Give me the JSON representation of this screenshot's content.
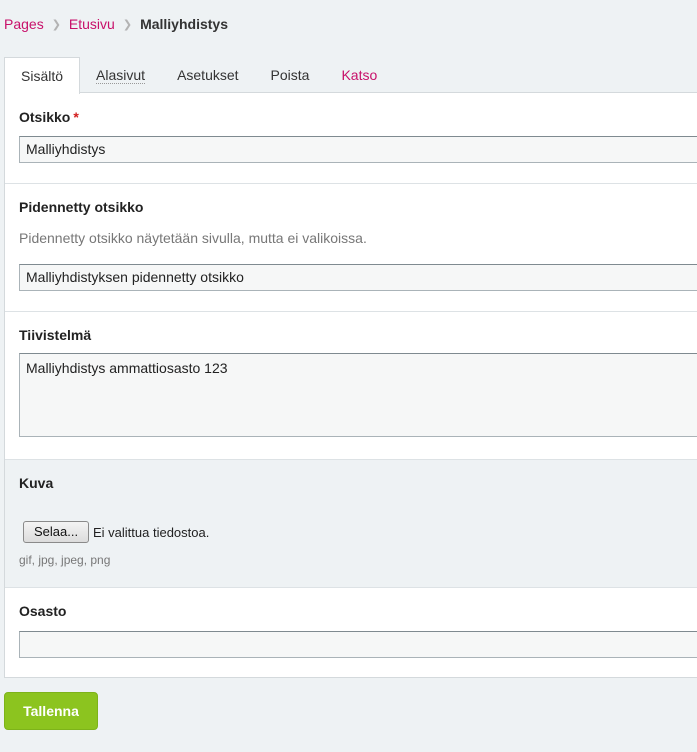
{
  "breadcrumb": {
    "items": [
      "Pages",
      "Etusivu"
    ],
    "current": "Malliyhdistys"
  },
  "tabs": [
    {
      "label": "Sisältö",
      "active": true
    },
    {
      "label": "Alasivut"
    },
    {
      "label": "Asetukset"
    },
    {
      "label": "Poista"
    },
    {
      "label": "Katso"
    }
  ],
  "form": {
    "title": {
      "label": "Otsikko",
      "required_mark": "*",
      "value": "Malliyhdistys"
    },
    "extended_title": {
      "label": "Pidennetty otsikko",
      "help": "Pidennetty otsikko näytetään sivulla, mutta ei valikoissa.",
      "value": "Malliyhdistyksen pidennetty otsikko"
    },
    "summary": {
      "label": "Tiivistelmä",
      "value": "Malliyhdistys ammattiosasto 123"
    },
    "image": {
      "label": "Kuva",
      "browse_label": "Selaa...",
      "status": "Ei valittua tiedostoa.",
      "allowed_types": "gif, jpg, jpeg, png"
    },
    "department": {
      "label": "Osasto",
      "value": ""
    }
  },
  "actions": {
    "save_label": "Tallenna"
  },
  "colors": {
    "accent_pink": "#c8106a",
    "save_green": "#8cc41f",
    "required_red": "#d21e1e"
  }
}
